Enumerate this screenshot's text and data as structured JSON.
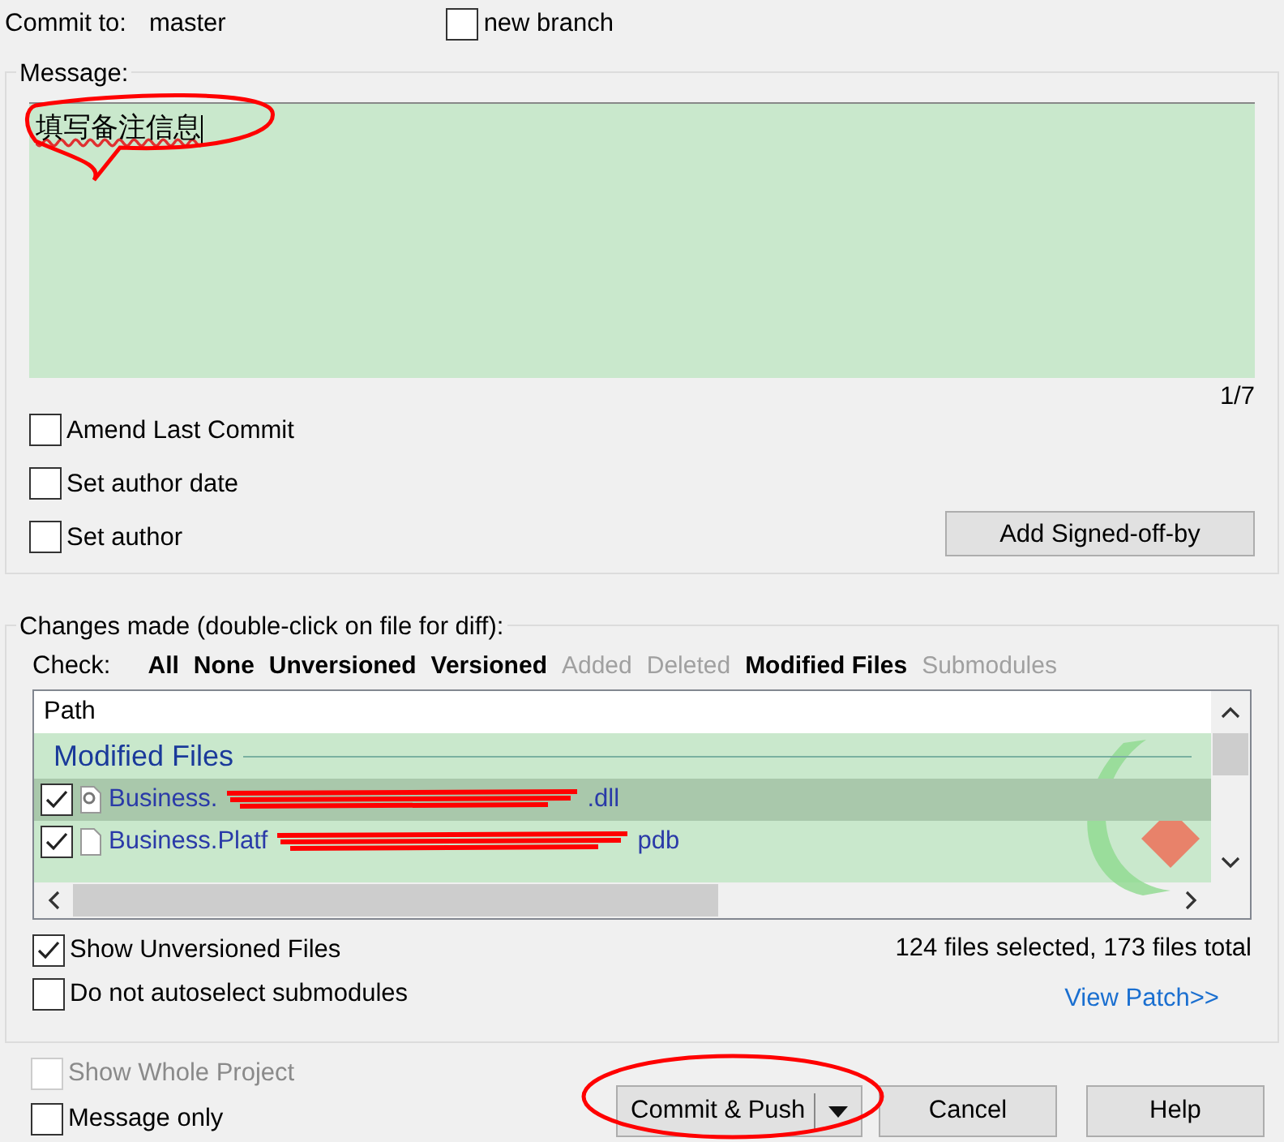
{
  "commit_to": {
    "label": "Commit to:",
    "branch": "master"
  },
  "new_branch": {
    "label": "new branch",
    "checked": false
  },
  "message": {
    "legend": "Message:",
    "value": "填写备注信息",
    "counter": "1/7"
  },
  "options": [
    {
      "label": "Amend Last Commit",
      "checked": false
    },
    {
      "label": "Set author date",
      "checked": false
    },
    {
      "label": "Set author",
      "checked": false
    }
  ],
  "signoff_button": "Add Signed-off-by",
  "changes": {
    "legend": "Changes made (double-click on file for diff):",
    "check_label": "Check:",
    "filters": [
      {
        "label": "All",
        "disabled": false
      },
      {
        "label": "None",
        "disabled": false
      },
      {
        "label": "Unversioned",
        "disabled": false
      },
      {
        "label": "Versioned",
        "disabled": false
      },
      {
        "label": "Added",
        "disabled": true
      },
      {
        "label": "Deleted",
        "disabled": true
      },
      {
        "label": "Modified Files",
        "disabled": false
      },
      {
        "label": "Submodules",
        "disabled": true
      }
    ],
    "list": {
      "column": "Path",
      "group": "Modified Files",
      "files": [
        {
          "start": "Business.",
          "end": ".dll",
          "checked": true,
          "selected": true,
          "kind": "gear"
        },
        {
          "start": "Business.Platf",
          "end": "pdb",
          "checked": true,
          "selected": false,
          "kind": "page"
        }
      ]
    },
    "options": [
      {
        "label": "Show Unversioned Files",
        "checked": true
      },
      {
        "label": "Do not autoselect submodules",
        "checked": false
      }
    ],
    "summary": "124 files selected, 173 files total",
    "view_patch": "View Patch>>"
  },
  "footer_options": [
    {
      "label": "Show Whole Project",
      "checked": false,
      "disabled": true
    },
    {
      "label": "Message only",
      "checked": false,
      "disabled": false
    }
  ],
  "buttons": [
    {
      "label": "Commit & Push",
      "kind": "split"
    },
    {
      "label": "Cancel",
      "kind": "plain"
    },
    {
      "label": "Help",
      "kind": "plain"
    }
  ]
}
